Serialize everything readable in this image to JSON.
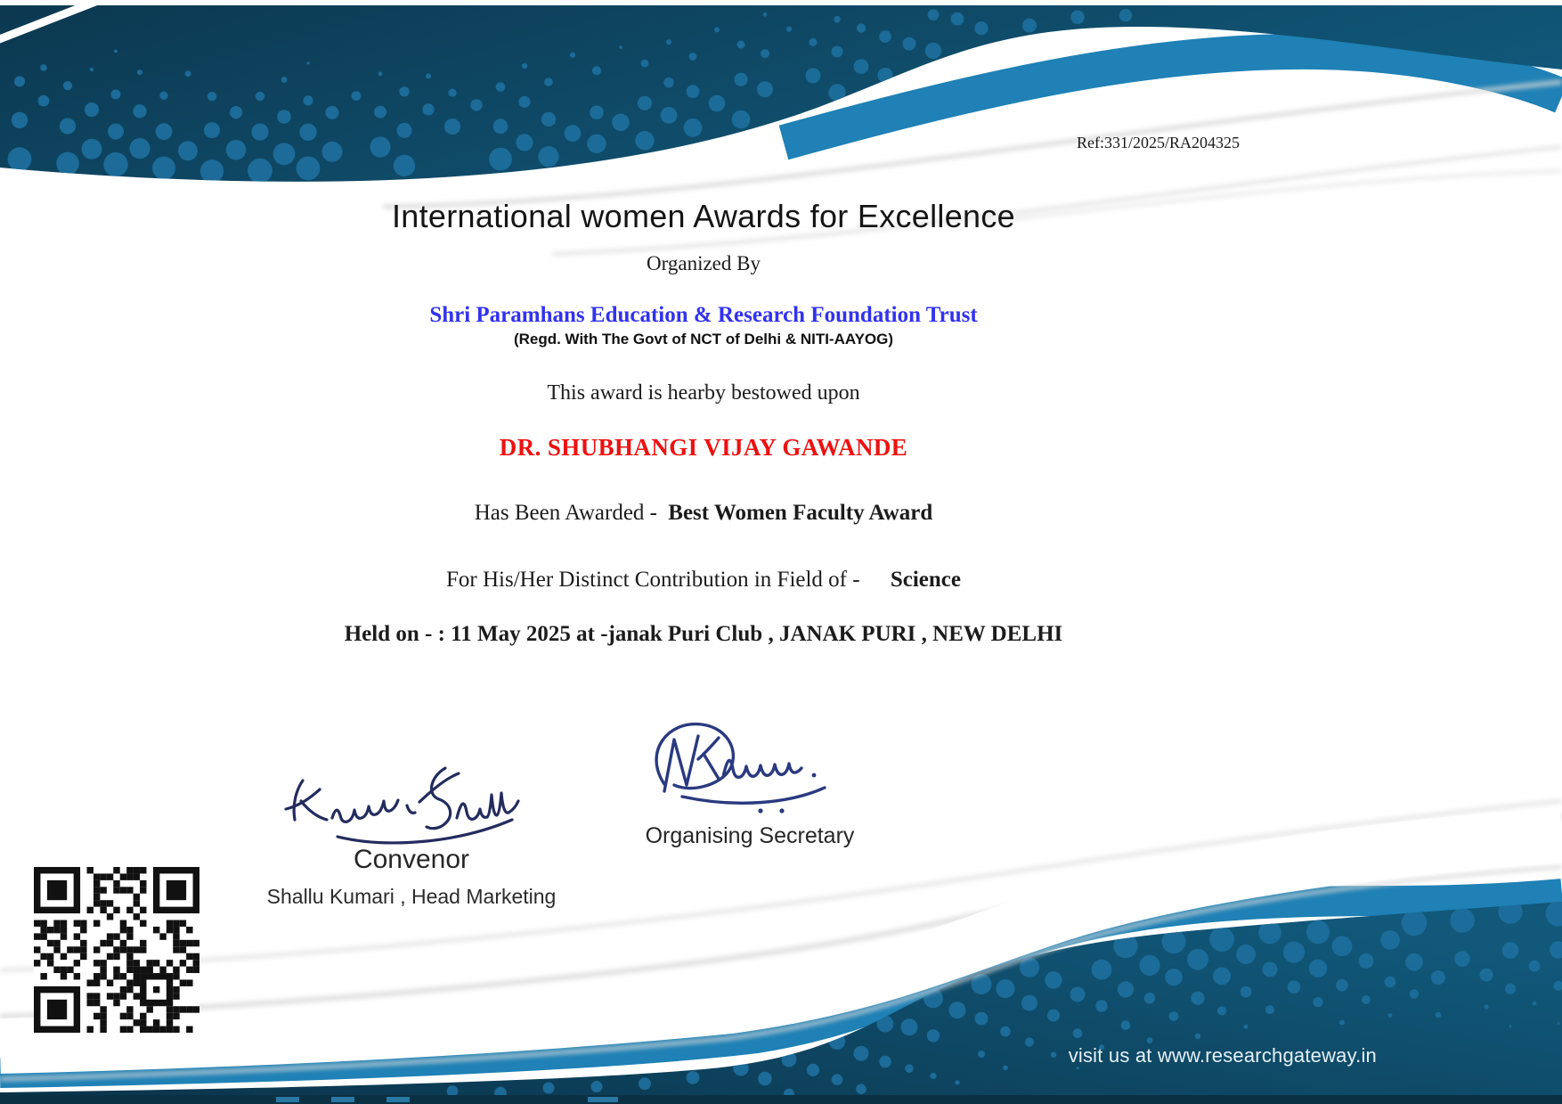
{
  "colors": {
    "dark_teal_1": "#0c3850",
    "dark_teal_2": "#11587a",
    "dot_blue": "#1d6f9d",
    "band_blue": "#1f81b5",
    "organization_blue": "#3232f0",
    "recipient_red": "#ed1110",
    "ink_navy": "#232c5e",
    "ink_blue": "#2a3a80",
    "footer_text_color": "#e6f1f7",
    "qr_black": "#111111"
  },
  "header": {
    "ref_label": "Ref:331/2025/RA204325"
  },
  "certificate": {
    "title": "International women Awards for Excellence",
    "organized_by": "Organized By",
    "organization": "Shri Paramhans Education & Research Foundation Trust",
    "registration": "(Regd. With The Govt of NCT of Delhi & NITI-AAYOG)",
    "bestowed_line": "This award is hearby bestowed upon",
    "recipient": "DR. SHUBHANGI VIJAY GAWANDE",
    "awarded_prefix": "Has Been Awarded -",
    "award_name": "Best Women Faculty Award",
    "field_prefix": "For His/Her Distinct Contribution in Field of -",
    "field_value": "Science",
    "event_line": "Held on - : 11 May 2025 at -janak Puri Club , JANAK PURI , NEW DELHI"
  },
  "signatures": {
    "convenor": {
      "title": "Convenor",
      "name_line": "Shallu Kumari , Head Marketing",
      "signature_name": "Kumari Shallu"
    },
    "organising_secretary": {
      "title": "Organising Secretary",
      "signature_name": "NKhanna."
    }
  },
  "footer": {
    "visit_text": "visit us at www.researchgateway.in"
  },
  "qr": {
    "icon_name": "qr-code"
  }
}
